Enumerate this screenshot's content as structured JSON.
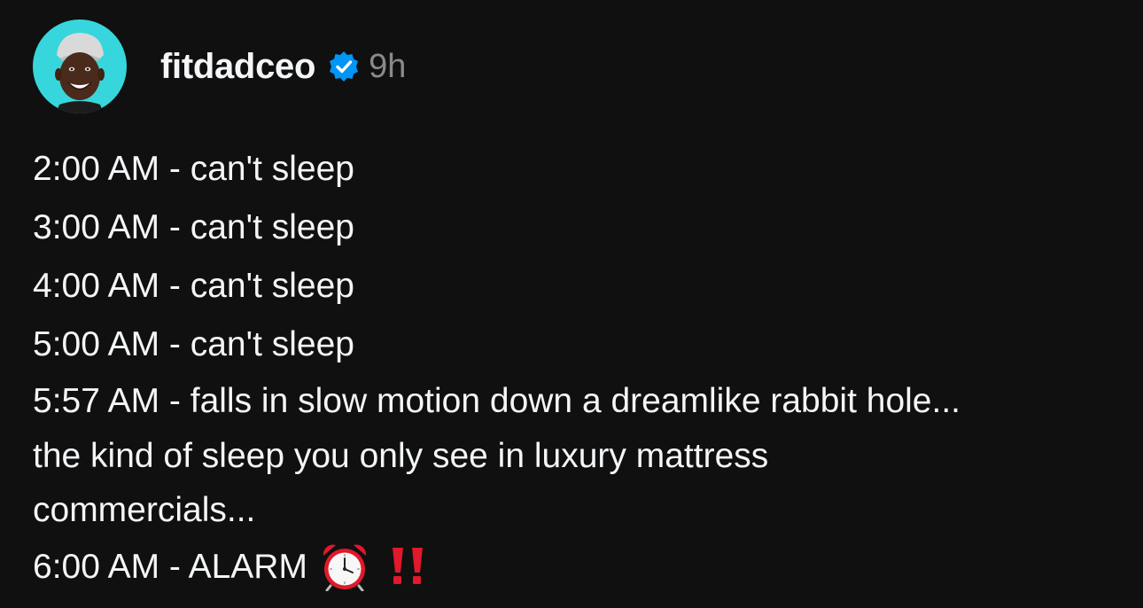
{
  "post": {
    "username": "fitdadceo",
    "timestamp": "9h",
    "lines": [
      "2:00 AM - can't sleep",
      "3:00 AM - can't sleep",
      "4:00 AM - can't sleep",
      "5:00 AM - can't sleep",
      "5:57 AM - falls in slow motion down a dreamlike rabbit hole...",
      "the kind of sleep you only see in luxury mattress",
      "commercials...",
      "6:00 AM - ALARM"
    ],
    "alarm_emoji": "alarm-clock-icon",
    "bangs_emoji": "double-exclamation-icon"
  },
  "colors": {
    "background": "#101010",
    "text": "#f3f5f7",
    "muted": "#8a8a8a",
    "avatar_bg": "#36d6dc",
    "verified": "#0095f6",
    "accent_red": "#e0192b"
  }
}
